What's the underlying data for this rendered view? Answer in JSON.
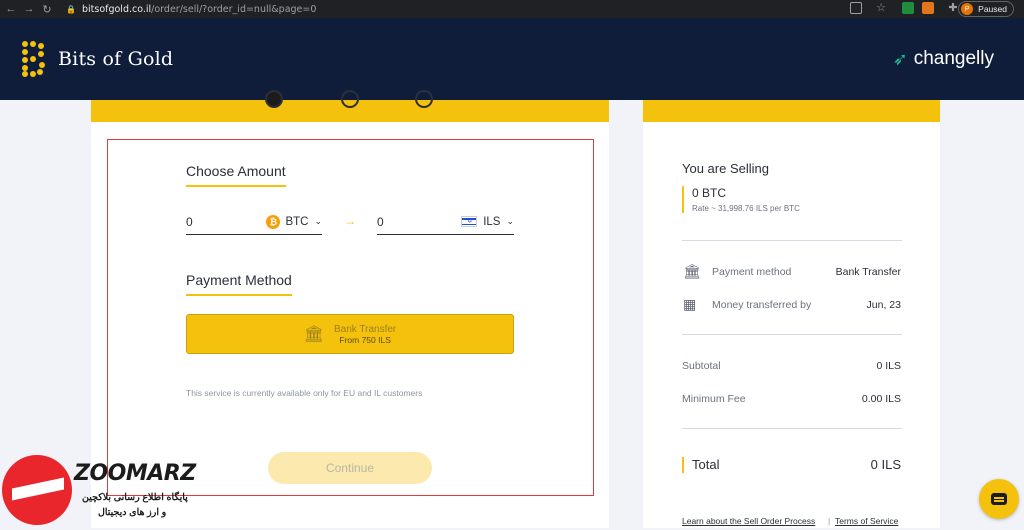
{
  "browser": {
    "url_host": "bitsofgold.co.il",
    "url_path": "/order/sell/?order_id=null&page=0",
    "profile_initial": "P",
    "profile_status": "Paused"
  },
  "header": {
    "brand": "Bits of Gold",
    "partner": "changelly"
  },
  "form": {
    "choose_amount_title": "Choose Amount",
    "from_value": "0",
    "from_currency": "BTC",
    "to_value": "0",
    "to_currency": "ILS",
    "payment_method_title": "Payment Method",
    "method_label": "Bank Transfer",
    "method_sub": "From 750 ILS",
    "availability_note": "This service is currently available only for EU and IL customers",
    "continue_label": "Continue"
  },
  "summary": {
    "selling_title": "You are Selling",
    "selling_amount": "0 BTC",
    "rate": "Rate ~ 31,998.76 ILS per BTC",
    "payment_method_label": "Payment method",
    "payment_method_value": "Bank Transfer",
    "transfer_label": "Money transferred by",
    "transfer_value": "Jun, 23",
    "subtotal_label": "Subtotal",
    "subtotal_value": "0 ILS",
    "fee_label": "Minimum Fee",
    "fee_value": "0.00 ILS",
    "total_label": "Total",
    "total_value": "0 ILS",
    "link_process": "Learn about the Sell Order Process",
    "link_terms": "Terms of Service"
  },
  "watermark": {
    "brand": "ZOOMARZ",
    "line1": "پایگاه اطلاع رسانی بلاکچین",
    "line2": "و ارز های دیجیتال"
  },
  "colors": {
    "accent": "#f4c20d",
    "header_bg": "#0f1d3b",
    "highlight_frame": "#e33b3b"
  }
}
